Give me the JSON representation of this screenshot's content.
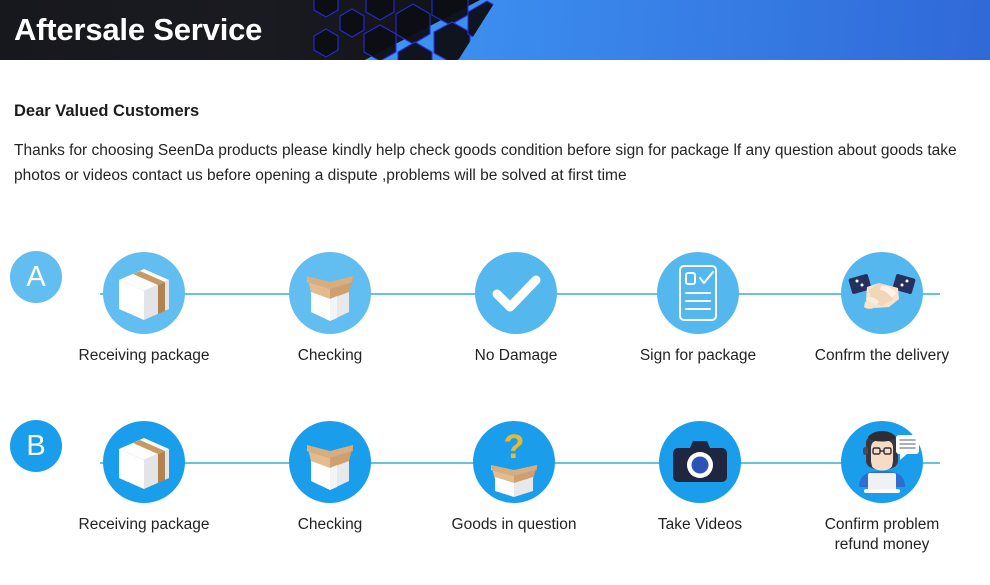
{
  "banner": {
    "title": "Aftersale Service",
    "dark_color": "#17181d",
    "hex_outline_color": "#2a2adf",
    "gradient_from": "#55c8fb",
    "gradient_to": "#3069d8"
  },
  "intro": {
    "heading": "Dear Valued Customers",
    "body": "Thanks for choosing SeenDa products please kindly help check goods condition before sign for package lf any question about goods take photos or videos contact us before opening a dispute ,problems will be solved at first time"
  },
  "rows": [
    {
      "badge": "A",
      "badge_color": "#62bdf0",
      "steps": [
        {
          "icon": "closed-box-icon",
          "label": "Receiving package"
        },
        {
          "icon": "open-box-icon",
          "label": "Checking"
        },
        {
          "icon": "check-circle-icon",
          "label": "No Damage"
        },
        {
          "icon": "signed-document-icon",
          "label": "Sign for package"
        },
        {
          "icon": "handshake-icon",
          "label": "Confrm the delivery"
        }
      ]
    },
    {
      "badge": "B",
      "badge_color": "#1a9eeb",
      "steps": [
        {
          "icon": "closed-box-icon",
          "label": "Receiving package"
        },
        {
          "icon": "open-box-icon",
          "label": "Checking"
        },
        {
          "icon": "question-box-icon",
          "label": "Goods in question"
        },
        {
          "icon": "camera-icon",
          "label": "Take Videos"
        },
        {
          "icon": "support-agent-icon",
          "label": "Confirm problem\nrefund money"
        }
      ]
    }
  ],
  "colors": {
    "circle_light": "#62bdf0",
    "circle_strong": "#1a9eeb",
    "connector_line": "#4fb8cf",
    "box_tape": "#c89a63",
    "box_cardboard": "#d9ae7e",
    "question_mark": "#e8b92e",
    "sleeve_navy": "#26305e",
    "skin": "#f6dcc4",
    "text": "#232323"
  }
}
